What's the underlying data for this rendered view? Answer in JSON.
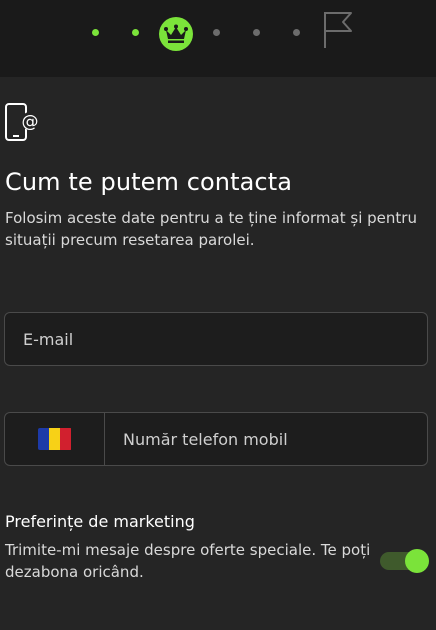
{
  "progress": {
    "steps_total": 7,
    "current_step": 3,
    "done_color": "#7be33a",
    "todo_color": "#6c6c6c",
    "current_icon": "crown-icon",
    "final_icon": "flag-icon"
  },
  "section": {
    "icon": "contact-phone-icon",
    "title": "Cum te putem contacta",
    "description": "Folosim aceste date pentru a te ține informat și pentru situații precum resetarea parolei."
  },
  "email": {
    "placeholder": "E-mail"
  },
  "phone": {
    "country_flag": "romania-flag-icon",
    "placeholder": "Număr telefon mobil"
  },
  "marketing": {
    "title": "Preferințe de marketing",
    "text": "Trimite-mi mesaje despre oferte speciale. Te poți dezabona oricând.",
    "toggle_on": true
  },
  "colors": {
    "accent": "#7be33a",
    "background": "#252525",
    "header": "#1a1a1a"
  }
}
